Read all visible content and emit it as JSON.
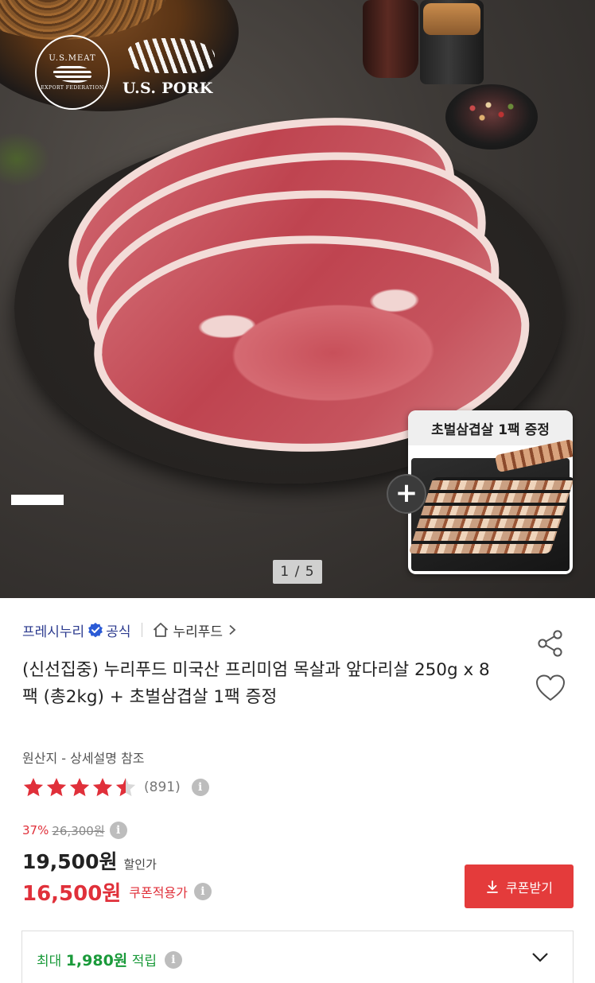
{
  "hero": {
    "logo_usmeat_top": "U.S.MEAT",
    "logo_usmeat_bottom": "EXPORT FEDERATION",
    "logo_uspork": "U.S. PORK",
    "promo_title": "초벌삼겹살 1팩 증정",
    "plus_symbol": "+",
    "page_counter": "1 / 5"
  },
  "seller": {
    "name": "프레시누리",
    "official": "공식",
    "brand": "누리푸드"
  },
  "product": {
    "title": "(신선집중) 누리푸드 미국산 프리미엄 목살과 앞다리살 250g x 8팩 (총2kg) + 초벌삼겹살 1팩 증정",
    "origin": "원산지 - 상세설명 참조",
    "rating": 4.5,
    "review_count": "(891)"
  },
  "price": {
    "discount_rate": "37%",
    "original_price": "26,300원",
    "sale_price": "19,500원",
    "sale_label": "할인가",
    "coupon_price": "16,500원",
    "coupon_label": "쿠폰적용가",
    "coupon_button": "쿠폰받기"
  },
  "points": {
    "prefix": "최대",
    "amount": "1,980원",
    "suffix": "적립"
  },
  "icons": {
    "info": "i",
    "verified": "verified-check-icon",
    "home": "home-icon",
    "share": "share-icon",
    "heart": "heart-icon",
    "download": "download-icon",
    "chevron_down": "chevron-down-icon"
  },
  "colors": {
    "accent_red": "#e43b3b",
    "seller_blue": "#2b3a8e",
    "points_green": "#1a9a3a",
    "star_red": "#e0303a"
  }
}
